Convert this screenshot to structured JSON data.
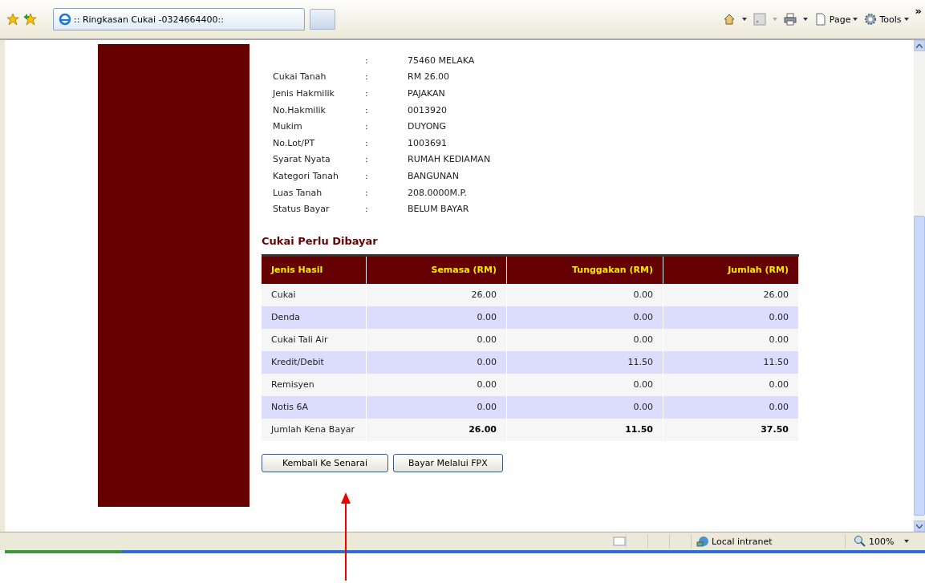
{
  "browser": {
    "tab_title": ":: Ringkasan Cukai -0324664400::",
    "toolbar": [
      {
        "label": "Page"
      },
      {
        "label": "Tools"
      }
    ],
    "overflow": "»"
  },
  "details": [
    {
      "separator": ":",
      "value": "75460 MELAKA"
    },
    {
      "label": "Cukai Tanah",
      "separator": ":",
      "value": "RM 26.00"
    },
    {
      "label": "Jenis Hakmilik",
      "separator": ":",
      "value": "PAJAKAN"
    },
    {
      "label": "No.Hakmilik",
      "separator": ":",
      "value": "0013920"
    },
    {
      "label": "Mukim",
      "separator": ":",
      "value": "DUYONG"
    },
    {
      "label": "No.Lot/PT",
      "separator": ":",
      "value": "1003691"
    },
    {
      "label": "Syarat Nyata",
      "separator": ":",
      "value": "RUMAH KEDIAMAN"
    },
    {
      "label": "Kategori Tanah",
      "separator": ":",
      "value": "BANGUNAN"
    },
    {
      "label": "Luas Tanah",
      "separator": ":",
      "value": "208.0000M.P."
    },
    {
      "label": "Status Bayar",
      "separator": ":",
      "value": "BELUM BAYAR"
    }
  ],
  "section_title": "Cukai Perlu Dibayar",
  "table": {
    "columns": [
      "Jenis Hasil",
      "Semasa (RM)",
      "Tunggakan (RM)",
      "Jumlah (RM)"
    ],
    "rows": [
      {
        "kind": "item",
        "cells": [
          "Cukai",
          "26.00",
          "0.00",
          "26.00"
        ]
      },
      {
        "kind": "item",
        "cells": [
          "Denda",
          "0.00",
          "0.00",
          "0.00"
        ]
      },
      {
        "kind": "item",
        "cells": [
          "Cukai Tali Air",
          "0.00",
          "0.00",
          "0.00"
        ]
      },
      {
        "kind": "item",
        "cells": [
          "Kredit/Debit",
          "0.00",
          "11.50",
          "11.50"
        ]
      },
      {
        "kind": "item",
        "cells": [
          "Remisyen",
          "0.00",
          "0.00",
          "0.00"
        ]
      },
      {
        "kind": "item",
        "cells": [
          "Notis 6A",
          "0.00",
          "0.00",
          "0.00"
        ]
      },
      {
        "kind": "total",
        "cells": [
          "Jumlah Kena Bayar",
          "26.00",
          "11.50",
          "37.50"
        ]
      }
    ]
  },
  "buttons": [
    "Kembali Ke Senarai",
    "Bayar Melalui FPX"
  ],
  "status_bar": {
    "zone": "Local intranet",
    "zoom": "100%"
  }
}
